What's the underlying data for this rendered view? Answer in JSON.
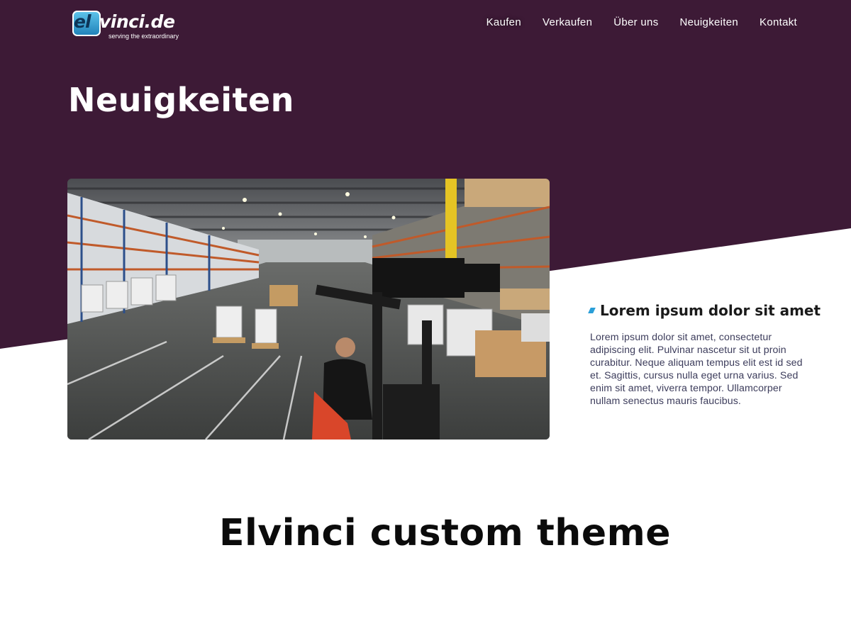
{
  "colors": {
    "hero_background": "#3d1a36",
    "accent": "#2a9fd8",
    "text_dark": "#0b0b0b"
  },
  "header": {
    "logo": {
      "badge": "el",
      "word": "vinci.de",
      "tagline": "serving the extraordinary"
    },
    "nav": [
      {
        "label": "Kaufen"
      },
      {
        "label": "Verkaufen"
      },
      {
        "label": "Über uns"
      },
      {
        "label": "Neuigkeiten"
      },
      {
        "label": "Kontakt"
      }
    ]
  },
  "hero": {
    "title": "Neuigkeiten"
  },
  "post": {
    "image_icon": "warehouse-photo",
    "title": "Lorem ipsum dolor sit amet",
    "body": "Lorem ipsum dolor sit amet, consectetur adipiscing elit. Pulvinar nascetur sit ut proin curabitur. Neque aliquam tempus elit est id sed et. Sagittis, cursus nulla eget urna varius. Sed enim sit amet, viverra tempor. Ullamcorper nullam senectus mauris faucibus."
  },
  "section": {
    "title": "Elvinci custom theme"
  }
}
